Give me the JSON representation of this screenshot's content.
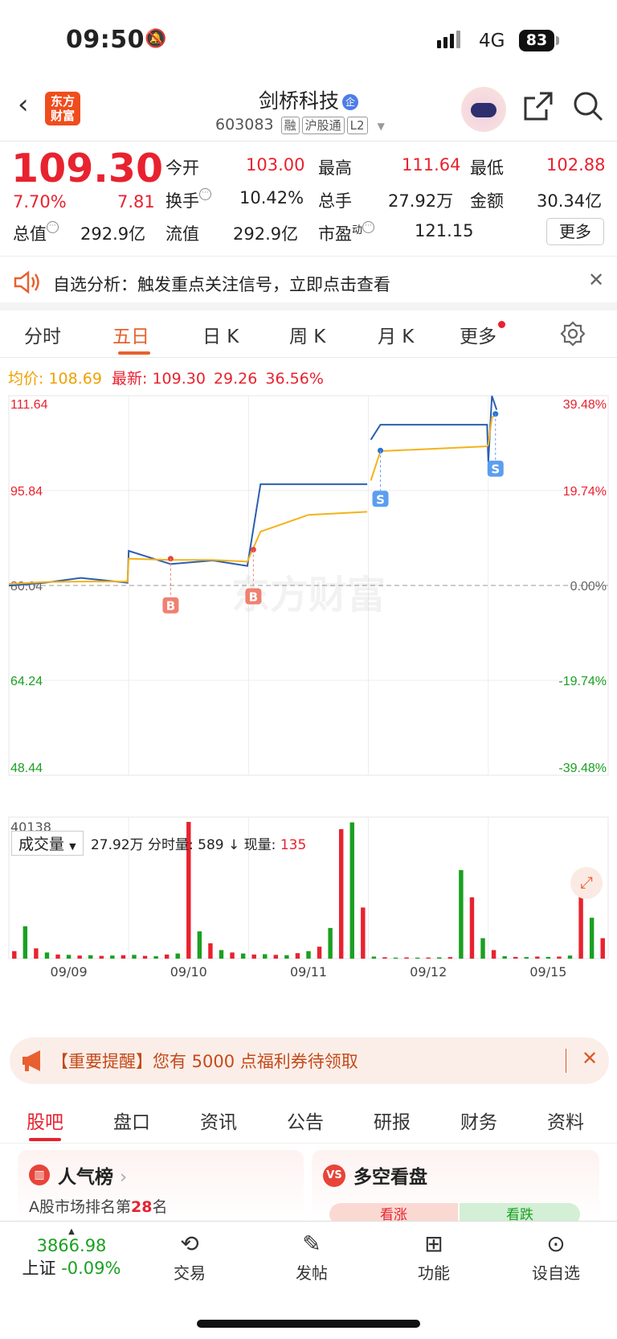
{
  "status": {
    "time": "09:50",
    "network": "4G",
    "battery": "83"
  },
  "header": {
    "logo": [
      "东方",
      "财富"
    ],
    "name": "剑桥科技",
    "badge": "企",
    "code": "603083",
    "tags": [
      "融",
      "沪股通",
      "L2"
    ]
  },
  "quote": {
    "price": "109.30",
    "change_pct": "7.70%",
    "change": "7.81",
    "open_label": "今开",
    "open": "103.00",
    "high_label": "最高",
    "high": "111.64",
    "low_label": "最低",
    "low": "102.88",
    "turnover_label": "换手",
    "turnover": "10.42%",
    "volume_label": "总手",
    "volume": "27.92万",
    "amount_label": "金额",
    "amount": "30.34亿",
    "mktcap_label": "总值",
    "mktcap": "292.9亿",
    "float_label": "流值",
    "float": "292.9亿",
    "pe_label": "市盈",
    "pe_sup": "动",
    "pe": "121.15",
    "more": "更多"
  },
  "alert": {
    "text": "自选分析：触发重点关注信号，立即点击查看"
  },
  "tabs": [
    "分时",
    "五日",
    "日 K",
    "周 K",
    "月 K",
    "更多"
  ],
  "legend": {
    "avg_label": "均价:",
    "avg": "108.69",
    "last_label": "最新:",
    "last": "109.30",
    "chg": "29.26",
    "pct": "36.56%"
  },
  "chart_data": {
    "type": "line",
    "y_left_ticks": [
      "111.64",
      "95.84",
      "80.04",
      "64.24",
      "48.44"
    ],
    "y_right_ticks": [
      "39.48%",
      "19.74%",
      "0.00%",
      "-19.74%",
      "-39.48%"
    ],
    "ylim": [
      48.44,
      111.64
    ],
    "base": 80.04,
    "x_ticks": [
      "09/09",
      "09/10",
      "09/11",
      "09/12",
      "09/15"
    ],
    "series": [
      {
        "name": "price",
        "color": "#2a5fb0",
        "values": [
          80.0,
          80.5,
          81.3,
          80.5,
          85.8,
          83.6,
          84.2,
          83.3,
          96.9,
          96.9,
          96.9,
          104.3,
          106.8,
          106.8,
          100.6,
          111.6,
          109.3
        ]
      },
      {
        "name": "avg",
        "color": "#f3b21c",
        "values": [
          80.3,
          80.6,
          80.7,
          80.7,
          84.5,
          84.3,
          84.3,
          84.0,
          89.0,
          91.8,
          92.3,
          97.5,
          102.4,
          103.2,
          103.5,
          108.0,
          108.69
        ]
      }
    ],
    "markers": [
      {
        "type": "B",
        "day": "09/10",
        "price": 84.5
      },
      {
        "type": "B",
        "day": "09/11",
        "price": 86.0
      },
      {
        "type": "S",
        "day": "09/12",
        "price": 102.5
      },
      {
        "type": "S",
        "day": "09/15",
        "price": 108.6
      }
    ],
    "volume": {
      "max_label": "40138",
      "label": "成交量",
      "total": "27.92万",
      "minute_label": "分时量:",
      "minute": "589",
      "current_label": "现量:",
      "current": "135",
      "values": [
        2200,
        9500,
        3000,
        1800,
        1200,
        1100,
        900,
        1000,
        800,
        900,
        1000,
        1100,
        800,
        700,
        1200,
        1500,
        40138,
        8000,
        4500,
        2500,
        1800,
        1500,
        1200,
        1300,
        1100,
        1000,
        1600,
        2200,
        3500,
        9000,
        38000,
        40000,
        15000,
        600,
        400,
        300,
        350,
        300,
        320,
        380,
        450,
        26000,
        18000,
        6000,
        2500,
        700,
        500,
        450,
        600,
        500,
        600,
        900,
        23000,
        12000,
        6000
      ]
    }
  },
  "watermark": "东方财富",
  "promo": {
    "text": "【重要提醒】您有 5000 点福利券待领取"
  },
  "subtabs": [
    "股吧",
    "盘口",
    "资讯",
    "公告",
    "研报",
    "财务",
    "资料"
  ],
  "cards": {
    "hot_title": "人气榜",
    "hot_sub_prefix": "A股市场排名第",
    "hot_rank": "28",
    "hot_sub_suffix": "名",
    "vs_title": "多空看盘",
    "vs_up": "看涨",
    "vs_down": "看跌"
  },
  "bottom": {
    "index": "3866.98",
    "index_name": "上证",
    "index_chg": "-0.09%",
    "nav": [
      "交易",
      "发帖",
      "功能",
      "设自选"
    ]
  }
}
